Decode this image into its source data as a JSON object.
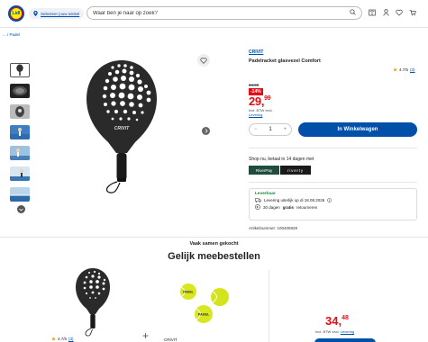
{
  "header": {
    "logo_text": "Lidl",
    "store_button": "Selecteer jouw winkel",
    "search_placeholder": "Waar ben je naar op zoek?"
  },
  "breadcrumb": {
    "prefix": "... /",
    "current": "Padel"
  },
  "product": {
    "brand": "CRIVIT",
    "title": "Padelracket glasvezel Comfort",
    "rating_value": "4.7/5",
    "rating_count": "(3)",
    "old_price": "34,99",
    "discount": "-14%",
    "price_int": "29,",
    "price_dec": "99",
    "vat_text": "Incl. BTW excl.",
    "vat_link": "Levering",
    "quantity": "1",
    "qty_minus": "−",
    "qty_plus": "+",
    "cart_button": "In Winkelwagen",
    "paddle_text": "CRIVIT"
  },
  "payment": {
    "title": "Shop nu, betaal in 14 dagen met",
    "riverty_pay": "RiverPay",
    "riverty": "riverty"
  },
  "delivery": {
    "availability": "Leverbaar",
    "delivery_text": "Levering uiterlijk op di 18.08.2026",
    "returns_prefix": "30 dagen",
    "returns_bold": "gratis",
    "returns_suffix": "retourneren"
  },
  "article_number": "Artikelnummer: 100405928",
  "bundle": {
    "often_bought": "Vaak samen gekocht",
    "title": "Gelijk meebestellen",
    "rating_value": "4.7/5",
    "rating_count": "(3)",
    "second_brand": "CRIVIT",
    "plus": "+",
    "price_int": "34,",
    "price_dec": "48",
    "vat_text": "Incl. BTW excl.",
    "vat_link": "Levering",
    "ball_text": "PADEL"
  },
  "colors": {
    "brand_blue": "#0050aa",
    "sale_red": "#e60a14",
    "available_green": "#1e8a3a"
  }
}
